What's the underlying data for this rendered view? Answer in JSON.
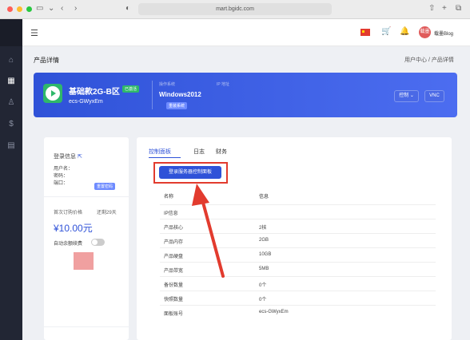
{
  "browser": {
    "url": "mart.bgidc.com"
  },
  "topbar": {
    "username": "载墨Blog",
    "avatar_text": "载墨"
  },
  "page": {
    "title": "产品详情",
    "breadcrumb": "用户中心 / 产品详情"
  },
  "product": {
    "name": "基础款2G-B区",
    "status": "已激活",
    "id": "ecs-GWyxEm",
    "os_label": "操作系统",
    "ip_label": "IP 地址",
    "os": "Windows2012",
    "reinstall": "重装系统",
    "control_label": "控制",
    "vnc_label": "VNC"
  },
  "left": {
    "title": "登录信息",
    "user_label": "用户名：",
    "pass_label": "密码：",
    "port_label": "端口：",
    "reset_label": "重置密码",
    "first_price_label": "首次订购价格",
    "renew_label": "还剩29天",
    "price": "¥10.00元",
    "auto_renew": "自动余额续费"
  },
  "tabs": [
    "控制面板",
    "日志",
    "财务"
  ],
  "login_button": "登录服务器控制面板",
  "table": {
    "headers": [
      "名称",
      "信息"
    ],
    "rows": [
      {
        "k": "IP信息",
        "v": ""
      },
      {
        "k": "产品核心",
        "v": "2核"
      },
      {
        "k": "产品内存",
        "v": "2GB"
      },
      {
        "k": "产品硬盘",
        "v": "10GB"
      },
      {
        "k": "产品带宽",
        "v": "5MB"
      },
      {
        "k": "备份数量",
        "v": "0个"
      },
      {
        "k": "快照数量",
        "v": "0个"
      },
      {
        "k": "面板账号",
        "v": "ecs-GWyxEm"
      }
    ]
  }
}
